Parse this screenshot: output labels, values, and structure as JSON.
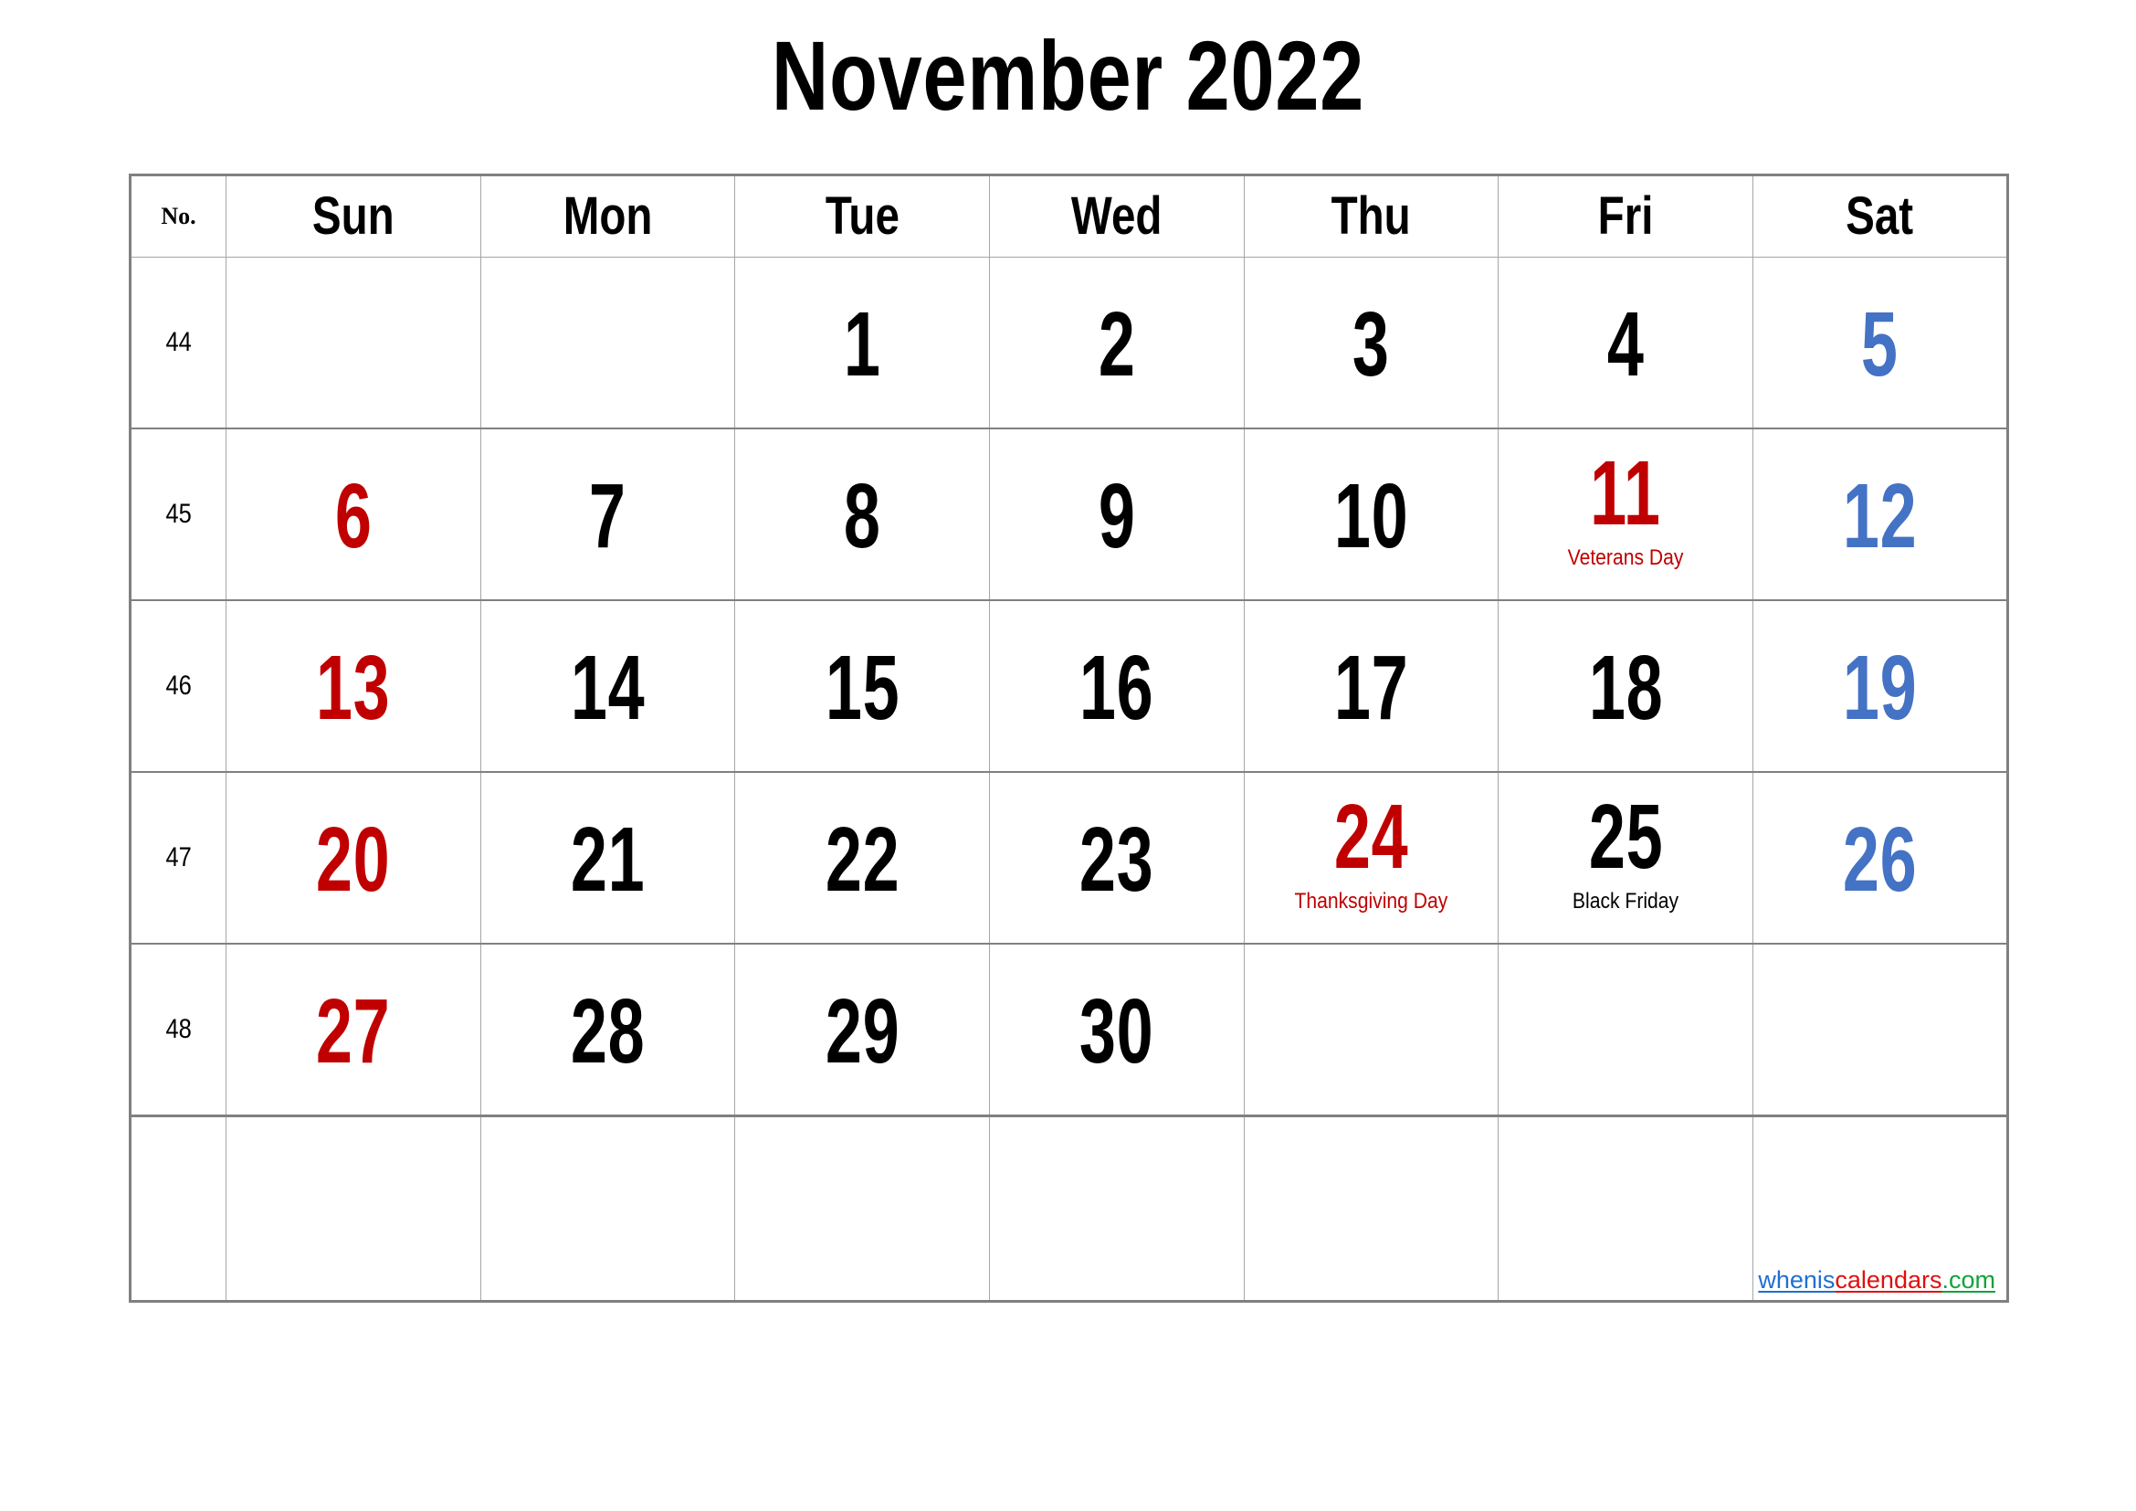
{
  "title": "November 2022",
  "colors": {
    "sunday": "#C00000",
    "saturday": "#4472C4",
    "weekday": "#000000",
    "grid_line": "#a6a6a6",
    "grid_outer": "#808080",
    "background": "#FFFFFF"
  },
  "header": {
    "week_no_label": "No.",
    "days": [
      "Sun",
      "Mon",
      "Tue",
      "Wed",
      "Thu",
      "Fri",
      "Sat"
    ]
  },
  "weeks": [
    {
      "number": "44",
      "days": [
        {
          "num": "",
          "kind": "empty",
          "event": "",
          "event_color": ""
        },
        {
          "num": "",
          "kind": "empty",
          "event": "",
          "event_color": ""
        },
        {
          "num": "1",
          "kind": "weekday",
          "event": "",
          "event_color": ""
        },
        {
          "num": "2",
          "kind": "weekday",
          "event": "",
          "event_color": ""
        },
        {
          "num": "3",
          "kind": "weekday",
          "event": "",
          "event_color": ""
        },
        {
          "num": "4",
          "kind": "weekday",
          "event": "",
          "event_color": ""
        },
        {
          "num": "5",
          "kind": "sat",
          "event": "",
          "event_color": ""
        }
      ]
    },
    {
      "number": "45",
      "days": [
        {
          "num": "6",
          "kind": "sun",
          "event": "",
          "event_color": ""
        },
        {
          "num": "7",
          "kind": "weekday",
          "event": "",
          "event_color": ""
        },
        {
          "num": "8",
          "kind": "weekday",
          "event": "",
          "event_color": ""
        },
        {
          "num": "9",
          "kind": "weekday",
          "event": "",
          "event_color": ""
        },
        {
          "num": "10",
          "kind": "weekday",
          "event": "",
          "event_color": ""
        },
        {
          "num": "11",
          "kind": "holiday",
          "event": "Veterans Day",
          "event_color": "red"
        },
        {
          "num": "12",
          "kind": "sat",
          "event": "",
          "event_color": ""
        }
      ]
    },
    {
      "number": "46",
      "days": [
        {
          "num": "13",
          "kind": "sun",
          "event": "",
          "event_color": ""
        },
        {
          "num": "14",
          "kind": "weekday",
          "event": "",
          "event_color": ""
        },
        {
          "num": "15",
          "kind": "weekday",
          "event": "",
          "event_color": ""
        },
        {
          "num": "16",
          "kind": "weekday",
          "event": "",
          "event_color": ""
        },
        {
          "num": "17",
          "kind": "weekday",
          "event": "",
          "event_color": ""
        },
        {
          "num": "18",
          "kind": "weekday",
          "event": "",
          "event_color": ""
        },
        {
          "num": "19",
          "kind": "sat",
          "event": "",
          "event_color": ""
        }
      ]
    },
    {
      "number": "47",
      "days": [
        {
          "num": "20",
          "kind": "sun",
          "event": "",
          "event_color": ""
        },
        {
          "num": "21",
          "kind": "weekday",
          "event": "",
          "event_color": ""
        },
        {
          "num": "22",
          "kind": "weekday",
          "event": "",
          "event_color": ""
        },
        {
          "num": "23",
          "kind": "weekday",
          "event": "",
          "event_color": ""
        },
        {
          "num": "24",
          "kind": "holiday",
          "event": "Thanksgiving Day",
          "event_color": "red"
        },
        {
          "num": "25",
          "kind": "weekday",
          "event": "Black Friday",
          "event_color": "black"
        },
        {
          "num": "26",
          "kind": "sat",
          "event": "",
          "event_color": ""
        }
      ]
    },
    {
      "number": "48",
      "days": [
        {
          "num": "27",
          "kind": "sun",
          "event": "",
          "event_color": ""
        },
        {
          "num": "28",
          "kind": "weekday",
          "event": "",
          "event_color": ""
        },
        {
          "num": "29",
          "kind": "weekday",
          "event": "",
          "event_color": ""
        },
        {
          "num": "30",
          "kind": "weekday",
          "event": "",
          "event_color": ""
        },
        {
          "num": "",
          "kind": "empty",
          "event": "",
          "event_color": ""
        },
        {
          "num": "",
          "kind": "empty",
          "event": "",
          "event_color": ""
        },
        {
          "num": "",
          "kind": "empty",
          "event": "",
          "event_color": ""
        }
      ]
    },
    {
      "number": "",
      "days": [
        {
          "num": "",
          "kind": "empty",
          "event": "",
          "event_color": ""
        },
        {
          "num": "",
          "kind": "empty",
          "event": "",
          "event_color": ""
        },
        {
          "num": "",
          "kind": "empty",
          "event": "",
          "event_color": ""
        },
        {
          "num": "",
          "kind": "empty",
          "event": "",
          "event_color": ""
        },
        {
          "num": "",
          "kind": "empty",
          "event": "",
          "event_color": ""
        },
        {
          "num": "",
          "kind": "empty",
          "event": "",
          "event_color": ""
        },
        {
          "num": "",
          "kind": "empty",
          "event": "",
          "event_color": ""
        }
      ]
    }
  ],
  "watermark": {
    "part1": "whenis",
    "part2": "calendars",
    "part3": ".com",
    "color1": "#1F6FD0",
    "color2": "#E01010",
    "color3": "#13A23C"
  }
}
